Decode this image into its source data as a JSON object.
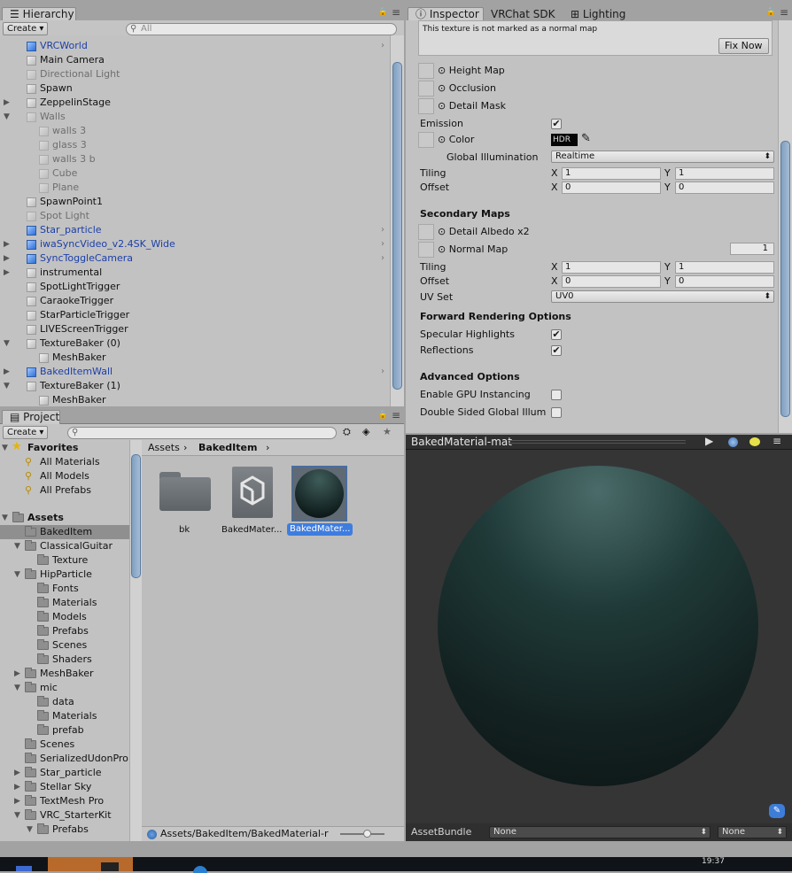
{
  "hierarchy": {
    "tab": "Hierarchy",
    "create": "Create",
    "search_placeholder": "All",
    "items": [
      {
        "label": "VRCWorld",
        "indent": 0,
        "icon": "blue",
        "arrow": true
      },
      {
        "label": "Main Camera",
        "indent": 0,
        "icon": "cube"
      },
      {
        "label": "Directional Light",
        "indent": 0,
        "icon": "dim"
      },
      {
        "label": "Spawn",
        "indent": 0,
        "icon": "cube"
      },
      {
        "label": "ZeppelinStage",
        "indent": 0,
        "icon": "cube",
        "expand": "right"
      },
      {
        "label": "Walls",
        "indent": 0,
        "icon": "dim",
        "expand": "down"
      },
      {
        "label": "walls 3",
        "indent": 1,
        "icon": "dim"
      },
      {
        "label": "glass 3",
        "indent": 1,
        "icon": "dim"
      },
      {
        "label": "walls 3 b",
        "indent": 1,
        "icon": "dim"
      },
      {
        "label": "Cube",
        "indent": 1,
        "icon": "dim"
      },
      {
        "label": "Plane",
        "indent": 1,
        "icon": "dim"
      },
      {
        "label": "SpawnPoint1",
        "indent": 0,
        "icon": "cube"
      },
      {
        "label": "Spot Light",
        "indent": 0,
        "icon": "dim"
      },
      {
        "label": "Star_particle",
        "indent": 0,
        "icon": "blue",
        "arrow": true
      },
      {
        "label": "iwaSyncVideo_v2.4SK_Wide",
        "indent": 0,
        "icon": "blue",
        "expand": "right",
        "arrow": true
      },
      {
        "label": "SyncToggleCamera",
        "indent": 0,
        "icon": "blue",
        "expand": "right",
        "arrow": true
      },
      {
        "label": "instrumental",
        "indent": 0,
        "icon": "cube",
        "expand": "right"
      },
      {
        "label": "SpotLightTrigger",
        "indent": 0,
        "icon": "cube"
      },
      {
        "label": "CaraokeTrigger",
        "indent": 0,
        "icon": "cube"
      },
      {
        "label": "StarParticleTrigger",
        "indent": 0,
        "icon": "cube"
      },
      {
        "label": "LIVEScreenTrigger",
        "indent": 0,
        "icon": "cube"
      },
      {
        "label": "TextureBaker (0)",
        "indent": 0,
        "icon": "cube",
        "expand": "down"
      },
      {
        "label": "MeshBaker",
        "indent": 1,
        "icon": "cube"
      },
      {
        "label": "BakedItemWall",
        "indent": 0,
        "icon": "blue",
        "expand": "right",
        "arrow": true
      },
      {
        "label": "TextureBaker (1)",
        "indent": 0,
        "icon": "cube",
        "expand": "down"
      },
      {
        "label": "MeshBaker",
        "indent": 1,
        "icon": "cube"
      }
    ]
  },
  "project": {
    "tab": "Project",
    "create": "Create",
    "favorites": {
      "label": "Favorites",
      "items": [
        "All Materials",
        "All Models",
        "All Prefabs"
      ]
    },
    "assets_label": "Assets",
    "tree": [
      {
        "label": "BakedItem",
        "indent": 1,
        "selected": true
      },
      {
        "label": "ClassicalGuitar",
        "indent": 1,
        "expand": "down"
      },
      {
        "label": "Texture",
        "indent": 2
      },
      {
        "label": "HipParticle",
        "indent": 1,
        "expand": "down"
      },
      {
        "label": "Fonts",
        "indent": 2
      },
      {
        "label": "Materials",
        "indent": 2
      },
      {
        "label": "Models",
        "indent": 2
      },
      {
        "label": "Prefabs",
        "indent": 2
      },
      {
        "label": "Scenes",
        "indent": 2
      },
      {
        "label": "Shaders",
        "indent": 2
      },
      {
        "label": "MeshBaker",
        "indent": 1,
        "expand": "right"
      },
      {
        "label": "mic",
        "indent": 1,
        "expand": "down"
      },
      {
        "label": "data",
        "indent": 2
      },
      {
        "label": "Materials",
        "indent": 2
      },
      {
        "label": "prefab",
        "indent": 2
      },
      {
        "label": "Scenes",
        "indent": 1
      },
      {
        "label": "SerializedUdonPro",
        "indent": 1
      },
      {
        "label": "Star_particle",
        "indent": 1,
        "expand": "right"
      },
      {
        "label": "Stellar Sky",
        "indent": 1,
        "expand": "right"
      },
      {
        "label": "TextMesh Pro",
        "indent": 1,
        "expand": "right"
      },
      {
        "label": "VRC_StarterKit",
        "indent": 1,
        "expand": "down"
      },
      {
        "label": "Prefabs",
        "indent": 2,
        "expand": "down"
      }
    ],
    "breadcrumb": [
      "Assets",
      "BakedItem"
    ],
    "files": [
      "bk",
      "BakedMater...",
      "BakedMater..."
    ],
    "path": "Assets/BakedItem/BakedMaterial-r"
  },
  "inspector": {
    "tabs": [
      "Inspector",
      "VRChat SDK",
      "Lighting"
    ],
    "notice": "This texture is not marked as a normal map",
    "fix_now": "Fix Now",
    "height_map": "Height Map",
    "occlusion": "Occlusion",
    "detail_mask": "Detail Mask",
    "emission": "Emission",
    "color": "Color",
    "hdr": "HDR",
    "global_illumination": "Global Illumination",
    "gi_value": "Realtime",
    "tiling": "Tiling",
    "offset": "Offset",
    "x": "X",
    "y": "Y",
    "tiling_x": "1",
    "tiling_y": "1",
    "offset_x": "0",
    "offset_y": "0",
    "secondary_maps": "Secondary Maps",
    "detail_albedo": "Detail Albedo x2",
    "normal_map": "Normal Map",
    "normal_value": "1",
    "tiling2_x": "1",
    "tiling2_y": "1",
    "offset2_x": "0",
    "offset2_y": "0",
    "uv_set": "UV Set",
    "uv_value": "UV0",
    "forward": "Forward Rendering Options",
    "specular": "Specular Highlights",
    "reflections": "Reflections",
    "advanced": "Advanced Options",
    "gpu_instancing": "Enable GPU Instancing",
    "double_sided": "Double Sided Global Illum",
    "checks": {
      "emission": true,
      "specular": true,
      "reflections": true,
      "gpu": false,
      "double_sided": false
    }
  },
  "preview": {
    "title": "BakedMaterial-mat",
    "assetbundle": "AssetBundle",
    "bundle_value": "None",
    "variant_value": "None",
    "sphere_color": "#1f3a38"
  },
  "taskbar": {
    "time": "19:37"
  }
}
